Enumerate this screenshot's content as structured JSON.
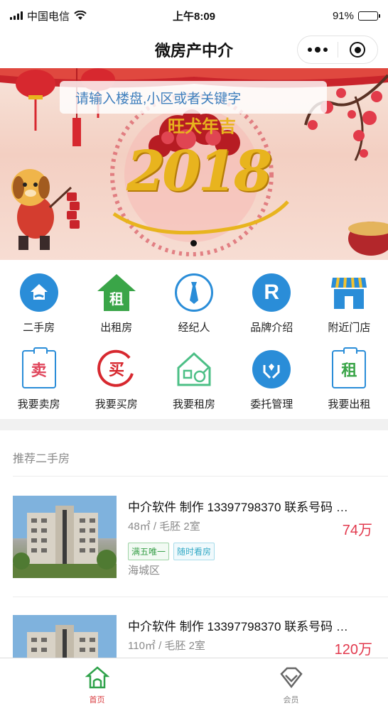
{
  "status_bar": {
    "carrier": "中国电信",
    "time": "上午8:09",
    "battery_text": "91%",
    "battery_level": 0.91
  },
  "nav": {
    "title": "微房产中介",
    "more_icon": "ellipsis-icon",
    "close_icon": "target-icon"
  },
  "banner": {
    "search_placeholder": "请输入楼盘,小区或者关键字",
    "year_text": "2018",
    "blessing_text": "旺犬年吉",
    "pager_count": 1,
    "colors": {
      "background": "#f3cfc2",
      "gold": "#e8b41e",
      "red": "#d7282f"
    }
  },
  "menu": {
    "row1": [
      {
        "label": "二手房",
        "icon": "house-hand-icon"
      },
      {
        "label": "出租房",
        "icon": "rent-house-icon",
        "glyph": "租"
      },
      {
        "label": "经纪人",
        "icon": "agent-tie-icon"
      },
      {
        "label": "品牌介绍",
        "icon": "brand-r-icon",
        "glyph": "R"
      },
      {
        "label": "附近门店",
        "icon": "store-icon"
      }
    ],
    "row2": [
      {
        "label": "我要卖房",
        "icon": "sell-board-icon",
        "glyph": "卖"
      },
      {
        "label": "我要买房",
        "icon": "buy-circle-icon",
        "glyph": "买"
      },
      {
        "label": "我要租房",
        "icon": "rent-key-icon"
      },
      {
        "label": "委托管理",
        "icon": "entrust-hands-icon"
      },
      {
        "label": "我要出租",
        "icon": "lease-board-icon",
        "glyph": "租"
      }
    ]
  },
  "recommend": {
    "section_title": "推荐二手房",
    "listings": [
      {
        "title": "中介软件 制作 13397798370 联系号码 …",
        "meta": "48㎡ / 毛胚 2室",
        "price": "74万",
        "tags": [
          "满五唯一",
          "随时看房"
        ],
        "district": "海城区"
      },
      {
        "title": "中介软件 制作 13397798370 联系号码 …",
        "meta": "110㎡ / 毛胚 2室",
        "price": "120万"
      }
    ]
  },
  "tab_bar": {
    "tabs": [
      {
        "label": "首页",
        "icon": "home-icon",
        "active": true
      },
      {
        "label": "会员",
        "icon": "diamond-icon",
        "active": false
      }
    ],
    "colors": {
      "active": "#d8393d",
      "inactive": "#888888"
    }
  }
}
